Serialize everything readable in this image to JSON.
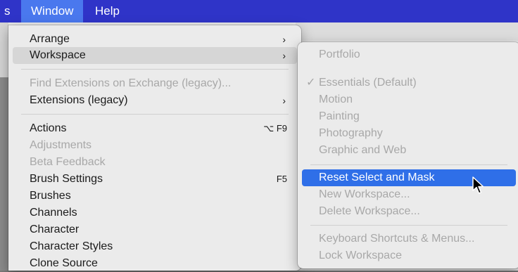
{
  "menubar": {
    "left_fragment": "s",
    "window_label": "Window",
    "help_label": "Help"
  },
  "window_menu": {
    "items": [
      {
        "label": "Arrange",
        "arrow": "›"
      },
      {
        "label": "Workspace",
        "arrow": "›"
      },
      {
        "label": "Find Extensions on Exchange (legacy)..."
      },
      {
        "label": "Extensions (legacy)",
        "arrow": "›"
      },
      {
        "label": "Actions",
        "shortcut": "⌥ F9"
      },
      {
        "label": "Adjustments"
      },
      {
        "label": "Beta Feedback"
      },
      {
        "label": "Brush Settings",
        "shortcut": "F5"
      },
      {
        "label": "Brushes"
      },
      {
        "label": "Channels"
      },
      {
        "label": "Character"
      },
      {
        "label": "Character Styles"
      },
      {
        "label": "Clone Source"
      }
    ]
  },
  "workspace_submenu": {
    "items": [
      {
        "label": "Portfolio"
      },
      {
        "label": "Essentials (Default)",
        "check": "✓"
      },
      {
        "label": "Motion"
      },
      {
        "label": "Painting"
      },
      {
        "label": "Photography"
      },
      {
        "label": "Graphic and Web"
      },
      {
        "label": "Reset Select and Mask"
      },
      {
        "label": "New Workspace..."
      },
      {
        "label": "Delete Workspace..."
      },
      {
        "label": "Keyboard Shortcuts & Menus..."
      },
      {
        "label": "Lock Workspace"
      }
    ]
  },
  "colors": {
    "menubar": "#2f34c8",
    "selected": "#2f6fe8",
    "disabled_text": "#a8a8a8"
  },
  "icons": {
    "cursor": "arrow-cursor-icon",
    "checkmark": "checkmark-icon",
    "submenu": "chevron-right-icon"
  }
}
